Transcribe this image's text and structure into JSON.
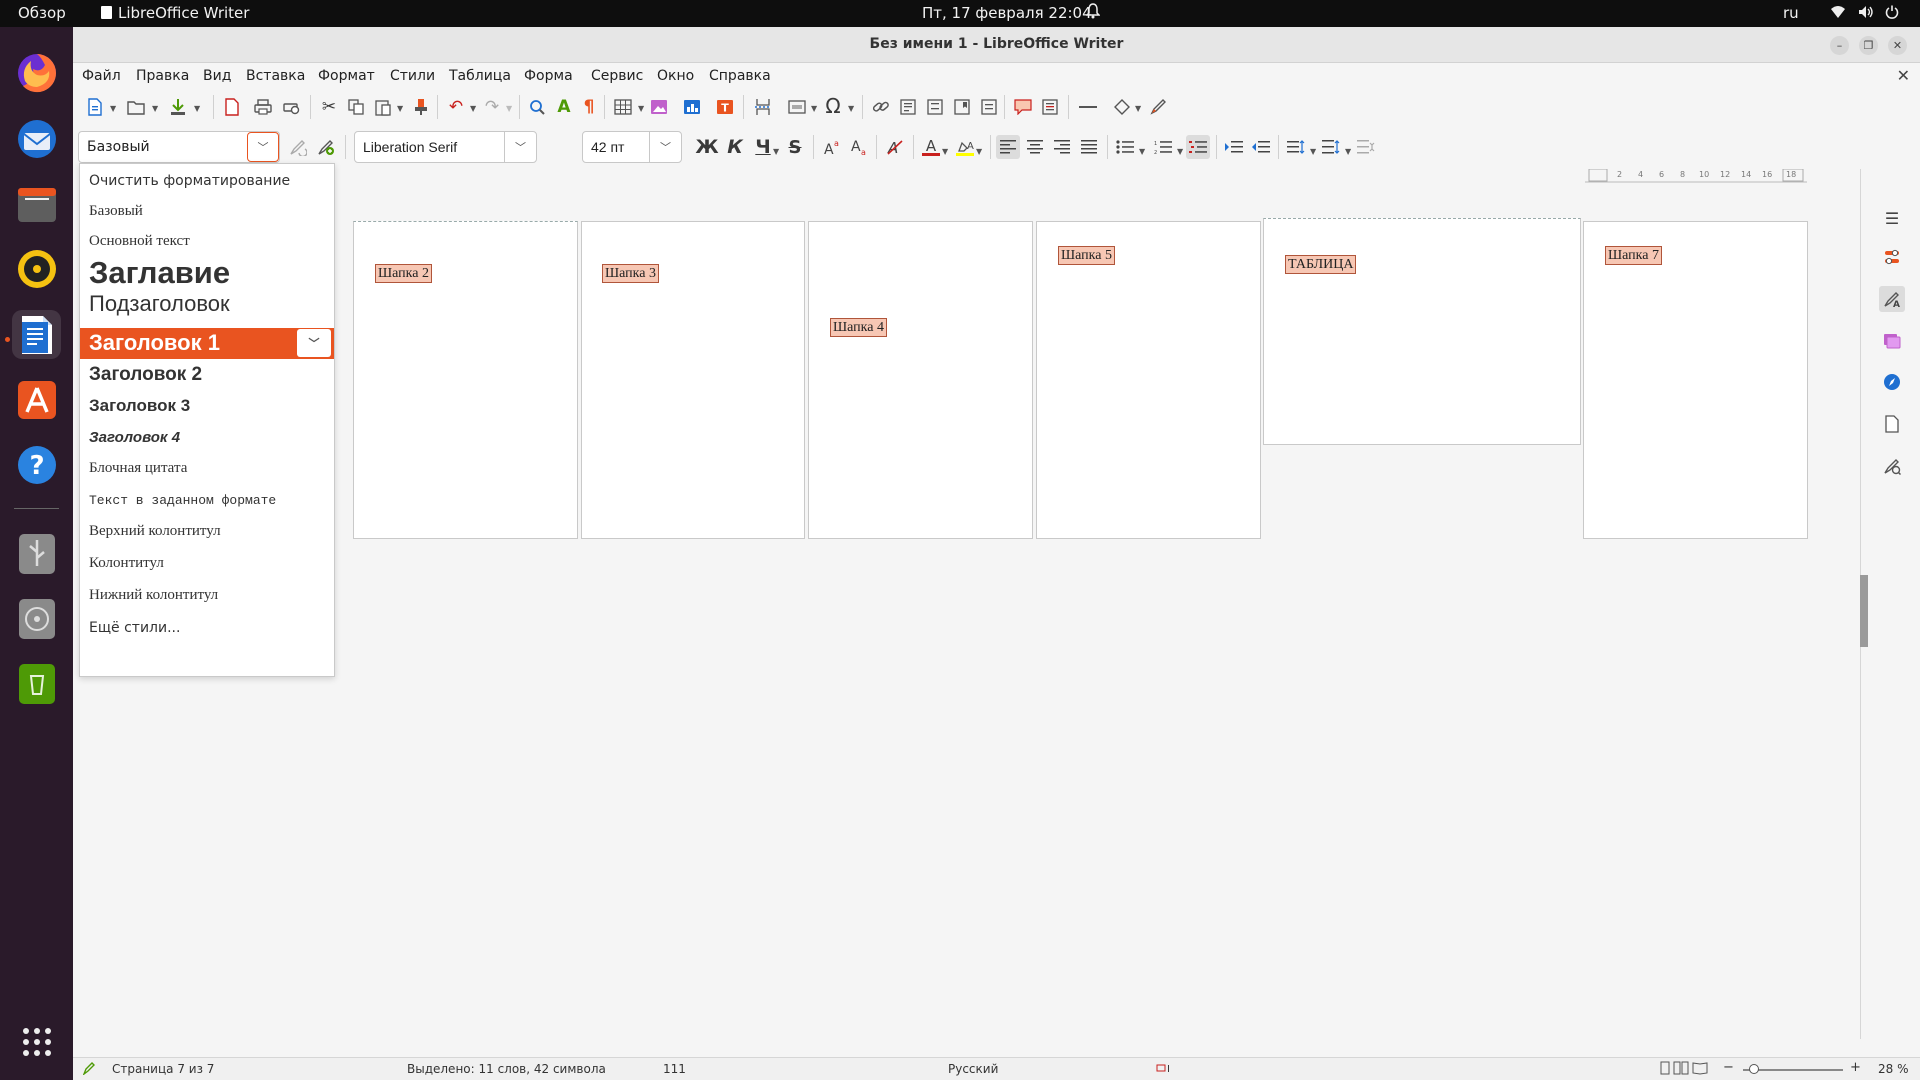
{
  "topbar": {
    "activities": "Обзор",
    "app_name": "LibreOffice Writer",
    "datetime": "Пт, 17 февраля  22:04",
    "language": "ru"
  },
  "dock": {
    "items": [
      "firefox-icon",
      "thunderbird-icon",
      "files-icon",
      "rhythmbox-icon",
      "libreoffice-writer-icon",
      "app-center-icon",
      "help-icon",
      "usb-drive-icon",
      "disc-icon",
      "trash-icon",
      "show-apps-icon"
    ]
  },
  "window": {
    "title": "Без имени 1 - LibreOffice Writer"
  },
  "menubar": {
    "items": [
      "Файл",
      "Правка",
      "Вид",
      "Вставка",
      "Формат",
      "Стили",
      "Таблица",
      "Форма",
      "Сервис",
      "Окно",
      "Справка"
    ]
  },
  "formatting": {
    "paragraph_style": "Базовый",
    "font_name": "Liberation Serif",
    "font_size": "42 пт",
    "bold": "Ж",
    "italic": "К",
    "underline": "Ч",
    "strike": "S"
  },
  "style_dropdown": {
    "clear": "Очистить форматирование",
    "items": [
      "Базовый",
      "Основной текст",
      "Заглавие",
      "Подзаголовок",
      "Заголовок 1",
      "Заголовок 2",
      "Заголовок 3",
      "Заголовок 4",
      "Блочная цитата",
      "Текст в заданном формате",
      "Верхний колонтитул",
      "Колонтитул",
      "Нижний колонтитул"
    ],
    "more": "Ещё стили...",
    "selected": "Заголовок 1"
  },
  "pages": {
    "header_fields": [
      "Шапка 2",
      "Шапка 3",
      "Шапка 4",
      "Шапка 5",
      "ТАБЛИЦА",
      "Шапка 7"
    ]
  },
  "ruler": {
    "ticks": [
      "2",
      "4",
      "6",
      "8",
      "10",
      "12",
      "14",
      "16",
      "18"
    ]
  },
  "statusbar": {
    "page": "Страница 7 из 7",
    "selection": "Выделено: 11 слов, 42 символа",
    "count": "111",
    "language": "Русский",
    "zoom": "28 %"
  },
  "colors": {
    "accent": "#e95420",
    "font_color": "#c9211e",
    "highlight": "#ffff00",
    "field_bg": "#f7c7b4"
  }
}
